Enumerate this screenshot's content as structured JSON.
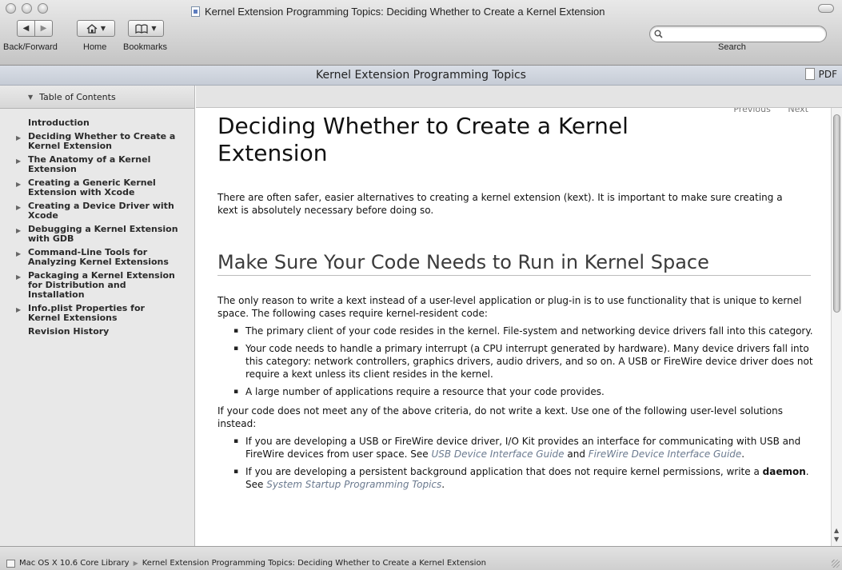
{
  "window": {
    "title": "Kernel Extension Programming Topics: Deciding Whether to Create a Kernel Extension"
  },
  "toolbar": {
    "back_forward_label": "Back/Forward",
    "home_label": "Home",
    "bookmarks_label": "Bookmarks",
    "search_label": "Search",
    "search_value": ""
  },
  "doc_header": {
    "title": "Kernel Extension Programming Topics",
    "pdf_label": "PDF"
  },
  "sidebar": {
    "toc_title": "Table of Contents",
    "items": [
      {
        "label": "Introduction",
        "expandable": false
      },
      {
        "label": "Deciding Whether to Create a Kernel Extension",
        "expandable": true
      },
      {
        "label": "The Anatomy of a Kernel Extension",
        "expandable": true
      },
      {
        "label": "Creating a Generic Kernel Extension with Xcode",
        "expandable": true
      },
      {
        "label": "Creating a Device Driver with Xcode",
        "expandable": true
      },
      {
        "label": "Debugging a Kernel Extension with GDB",
        "expandable": true
      },
      {
        "label": "Command-Line Tools for Analyzing Kernel Extensions",
        "expandable": true
      },
      {
        "label": "Packaging a Kernel Extension for Distribution and Installation",
        "expandable": true
      },
      {
        "label": "Info.plist Properties for Kernel Extensions",
        "expandable": true
      },
      {
        "label": "Revision History",
        "expandable": false
      }
    ]
  },
  "content": {
    "previous_label": "Previous",
    "next_label": "Next",
    "title": "Deciding Whether to Create a Kernel Extension",
    "intro": "There are often safer, easier alternatives to creating a kernel extension (kext). It is important to make sure creating a kext is absolutely necessary before doing so.",
    "section_title": "Make Sure Your Code Needs to Run in Kernel Space",
    "para1": "The only reason to write a kext instead of a user-level application or plug-in is to use functionality that is unique to kernel space. The following cases require kernel-resident code:",
    "list1": [
      "The primary client of your code resides in the kernel. File-system and networking device drivers fall into this category.",
      "Your code needs to handle a primary interrupt (a CPU interrupt generated by hardware). Many device drivers fall into this category: network controllers, graphics drivers, audio drivers, and so on. A USB or FireWire device driver does not require a kext unless its client resides in the kernel.",
      "A large number of applications require a resource that your code provides."
    ],
    "para2": "If your code does not meet any of the above criteria, do not write a kext. Use one of the following user-level solutions instead:",
    "list2_item1": {
      "text_a": "If you are developing a USB or FireWire device driver, I/O Kit provides an interface for communicating with USB and FireWire devices from user space. See ",
      "link_a": "USB Device Interface Guide",
      "text_b": " and ",
      "link_b": "FireWire Device Interface Guide",
      "text_c": "."
    },
    "list2_item2": {
      "text_a": "If you are developing a persistent background application that does not require kernel permissions, write a ",
      "term": "daemon",
      "text_b": ". See ",
      "link": "System Startup Programming Topics",
      "text_c": "."
    }
  },
  "statusbar": {
    "crumbs": [
      "Mac OS X 10.6 Core Library",
      "Kernel Extension Programming Topics: Deciding Whether to Create a Kernel Extension"
    ]
  }
}
